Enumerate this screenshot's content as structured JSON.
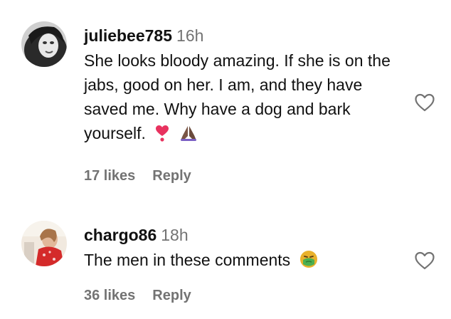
{
  "comments": [
    {
      "username": "juliebee785",
      "time": "16h",
      "text": "She looks bloody amazing. If she is on the jabs, good on her. I am, and they have saved me. Why have a dog and bark yourself.",
      "emojis": [
        "heart-exclamation",
        "folded-hands"
      ],
      "likes": "17 likes",
      "reply_label": "Reply"
    },
    {
      "username": "chargo86",
      "time": "18h",
      "text": "The men in these comments",
      "emojis": [
        "nauseated-face"
      ],
      "likes": "36 likes",
      "reply_label": "Reply"
    }
  ],
  "colors": {
    "muted": "#737373",
    "text": "#111111",
    "heart_emoji": "#e8325f",
    "hands_emoji": "#7a5646",
    "nausea_face": "#e9b12c",
    "nausea_green": "#4caf50"
  }
}
